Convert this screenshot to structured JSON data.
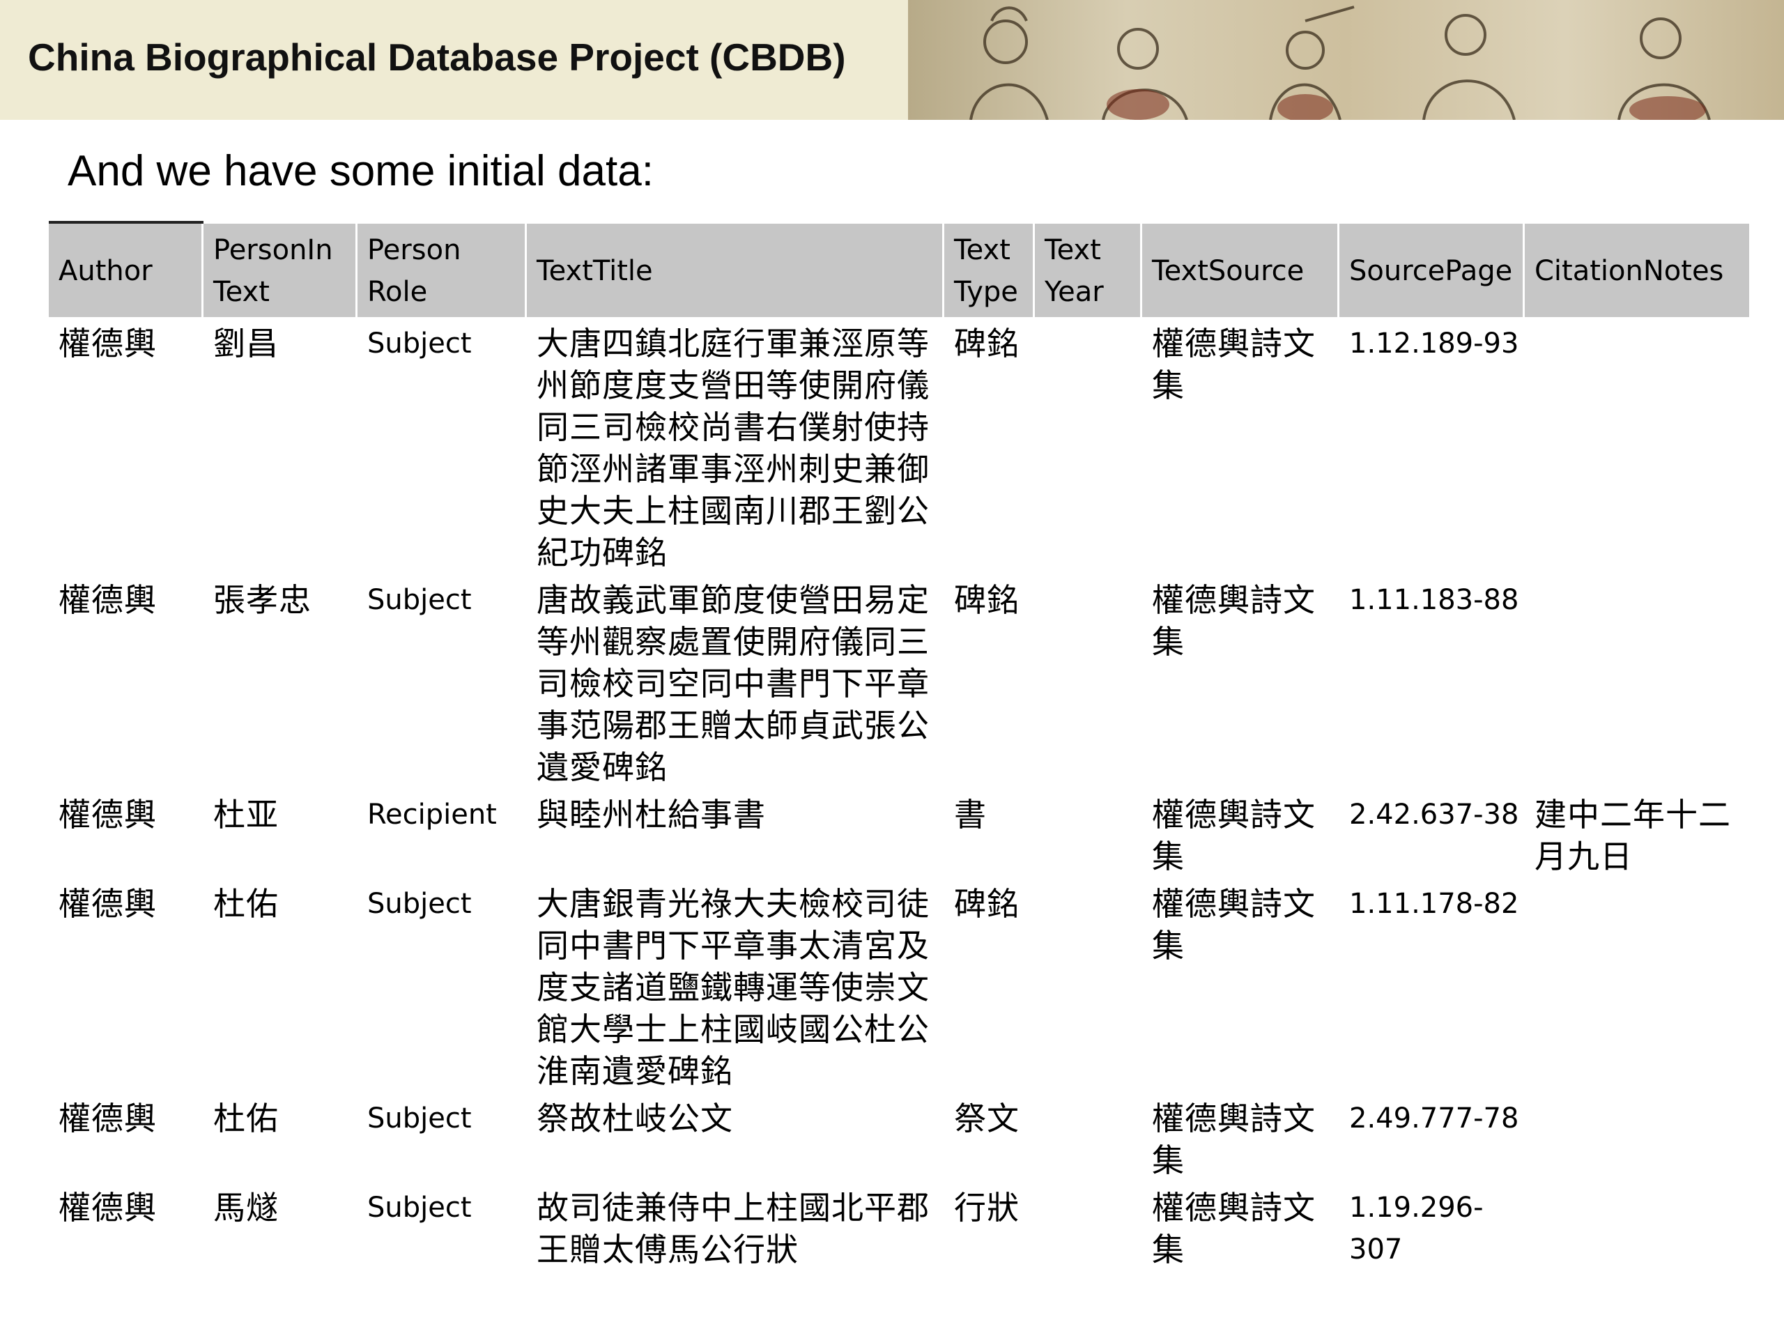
{
  "banner": {
    "title": "China Biographical Database Project (CBDB)"
  },
  "subtitle": "And we have some initial data:",
  "table": {
    "headers": [
      "Author",
      "PersonIn Text",
      "Person Role",
      "TextTitle",
      "Text Type",
      "Text Year",
      "TextSource",
      "SourcePage",
      "CitationNotes"
    ],
    "rows": [
      [
        "權德輿",
        "劉昌",
        "Subject",
        "大唐四鎮北庭行軍兼涇原等州節度度支營田等使開府儀同三司檢校尚書右僕射使持節涇州諸軍事涇州刺史兼御史大夫上柱國南川郡王劉公紀功碑銘",
        "碑銘",
        "",
        "權德輿詩文集",
        "1.12.189-93",
        ""
      ],
      [
        "權德輿",
        "張孝忠",
        "Subject",
        "唐故義武軍節度使營田易定等州觀察處置使開府儀同三司檢校司空同中書門下平章事范陽郡王贈太師貞武張公遺愛碑銘",
        "碑銘",
        "",
        "權德輿詩文集",
        "1.11.183-88",
        ""
      ],
      [
        "權德輿",
        "杜亚",
        "Recipient",
        "與睦州杜給事書",
        "書",
        "",
        "權德輿詩文集",
        "2.42.637-38",
        "建中二年十二月九日"
      ],
      [
        "權德輿",
        "杜佑",
        "Subject",
        "大唐銀青光祿大夫檢校司徒同中書門下平章事太清宮及度支諸道鹽鐵轉運等使崇文館大學士上柱國岐國公杜公淮南遺愛碑銘",
        "碑銘",
        "",
        "權德輿詩文集",
        "1.11.178-82",
        ""
      ],
      [
        "權德輿",
        "杜佑",
        "Subject",
        "祭故杜岐公文",
        "祭文",
        "",
        "權德輿詩文集",
        "2.49.777-78",
        ""
      ],
      [
        "權德輿",
        "馬燧",
        "Subject",
        "故司徒兼侍中上柱國北平郡王贈太傅馬公行狀",
        "行狀",
        "",
        "權德輿詩文集",
        "1.19.296-307",
        ""
      ]
    ]
  }
}
